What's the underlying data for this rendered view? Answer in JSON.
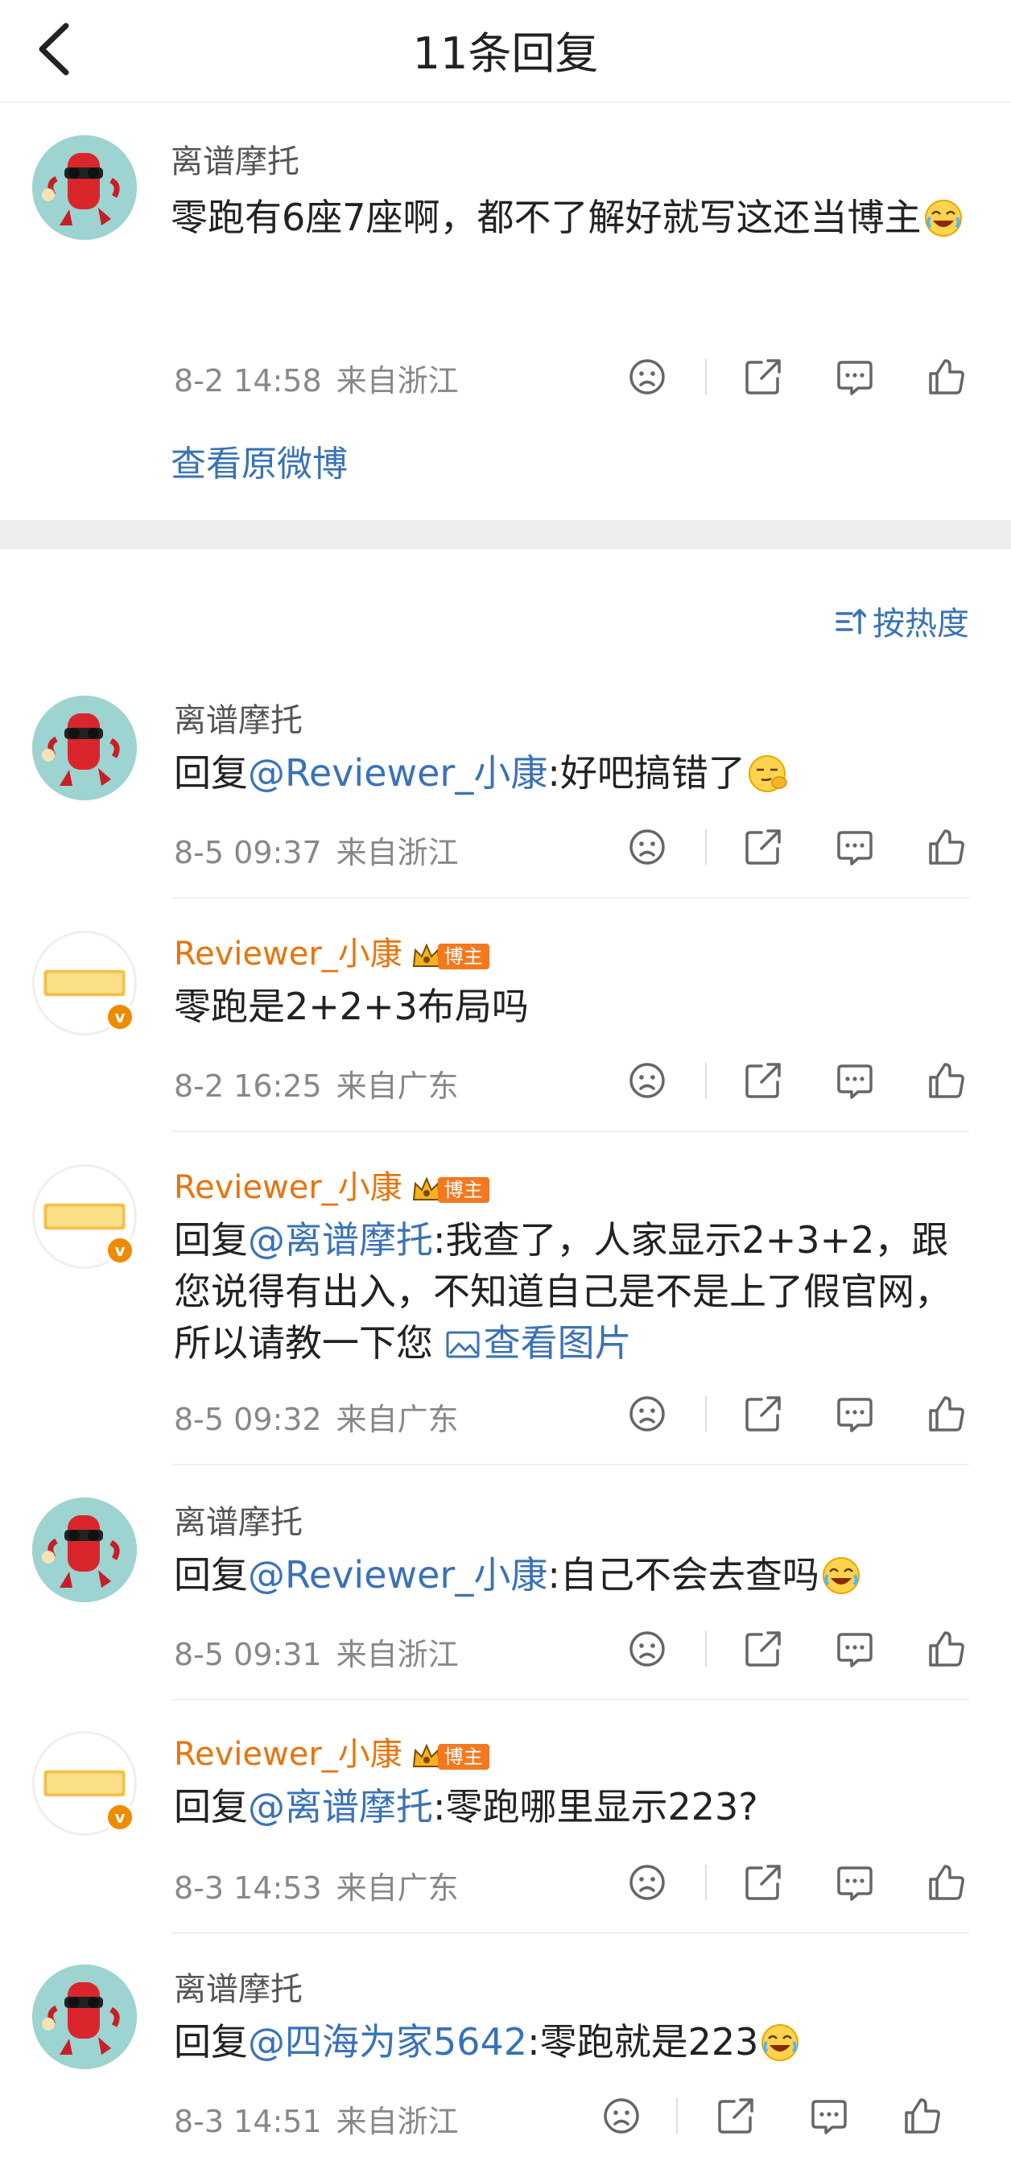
{
  "header": {
    "title": "11条回复"
  },
  "post": {
    "author": "离谱摩托",
    "text": "零跑有6座7座啊，都不了解好就写这还当博主",
    "time": "8-2 14:58",
    "location": "来自浙江",
    "view_original": "查看原微博"
  },
  "sort": {
    "label": "按热度"
  },
  "replies": [
    {
      "author": "离谱摩托",
      "reply_prefix": "回复",
      "mention": "@Reviewer_小康",
      "text": ":好吧搞错了",
      "time": "8-5 09:37",
      "location": "来自浙江"
    },
    {
      "author": "Reviewer_小康",
      "badge": "博主",
      "text": "零跑是2+2+3布局吗",
      "time": "8-2 16:25",
      "location": "来自广东"
    },
    {
      "author": "Reviewer_小康",
      "badge": "博主",
      "reply_prefix": "回复",
      "mention": "@离谱摩托",
      "text": ":我查了，人家显示2+3+2，跟您说得有出入，不知道自己是不是上了假官网，所以请教一下您",
      "pic_link": "查看图片",
      "time": "8-5 09:32",
      "location": "来自广东"
    },
    {
      "author": "离谱摩托",
      "reply_prefix": "回复",
      "mention": "@Reviewer_小康",
      "text": ":自己不会去查吗",
      "time": "8-5 09:31",
      "location": "来自浙江"
    },
    {
      "author": "Reviewer_小康",
      "badge": "博主",
      "reply_prefix": "回复",
      "mention": "@离谱摩托",
      "text": ":零跑哪里显示223?",
      "time": "8-3 14:53",
      "location": "来自广东"
    },
    {
      "author": "离谱摩托",
      "reply_prefix": "回复",
      "mention": "@四海为家5642",
      "text": ":零跑就是223",
      "time": "8-3 14:51",
      "location": "来自浙江"
    }
  ],
  "avatar_labels": {
    "reviewer": "Reviewer小康"
  },
  "colors": {
    "accent_blue": "#3a72b8",
    "vip_orange": "#e8740d",
    "badge_orange": "#f2791f"
  }
}
